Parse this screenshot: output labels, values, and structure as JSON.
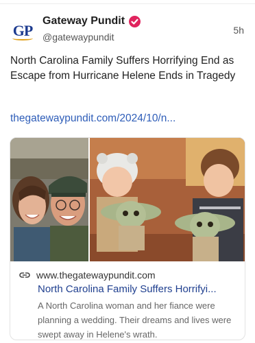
{
  "post": {
    "author_name": "Gateway Pundit",
    "author_handle": "@gatewaypundit",
    "avatar_text": "GP",
    "timestamp": "5h",
    "text": "North Carolina Family Suffers Horrifying End as Escape from Hurricane Helene Ends in Tragedy",
    "link": "thegatewaypundit.com/2024/10/n..."
  },
  "card": {
    "domain": "www.thegatewaypundit.com",
    "title": "North Carolina Family Suffers Horrifyi...",
    "description": "A North Carolina woman and her fiance were planning a wedding. Their dreams and lives were swept away in Helene's wrath."
  },
  "icons": {
    "verified": "verified-badge-icon",
    "link": "link-icon"
  },
  "colors": {
    "verified_badge": "#e0245e",
    "link_text": "#2e5db8",
    "card_title": "#1f3f8f",
    "avatar_blue": "#1d3b8f",
    "avatar_gold": "#e0a11b"
  }
}
